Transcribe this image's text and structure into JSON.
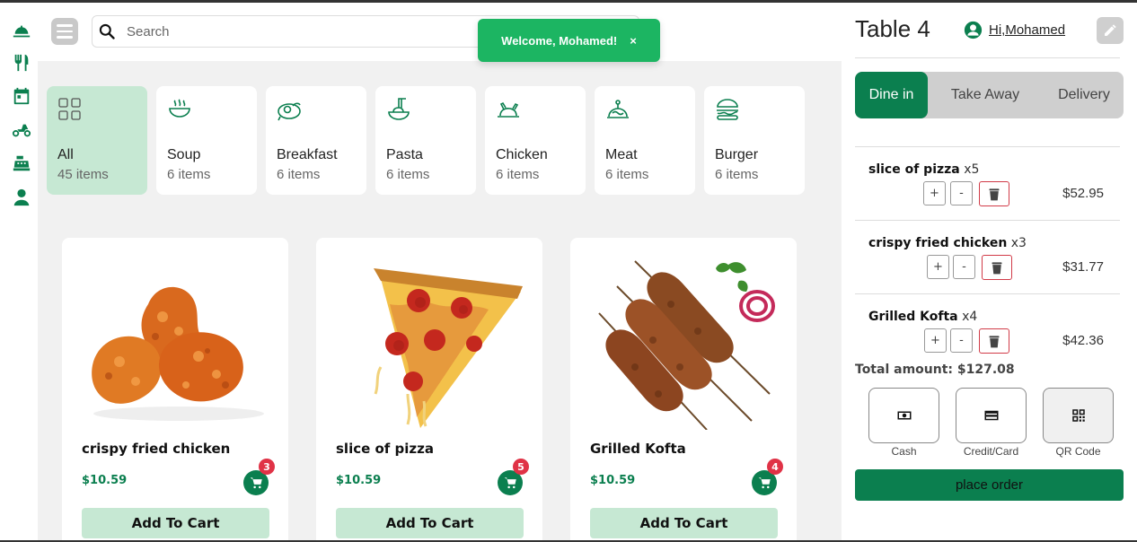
{
  "colors": {
    "accent": "#0b7f4f",
    "accent_light": "#c6e8d3",
    "toast": "#1cb562",
    "badge": "#e03246"
  },
  "sidebar": {
    "icons": [
      "bell-service-icon",
      "utensils-icon",
      "calendar-icon",
      "motorcycle-icon",
      "cash-register-icon",
      "user-icon"
    ]
  },
  "search": {
    "placeholder": "Search",
    "value": ""
  },
  "toast": {
    "message": "Welcome, Mohamed!",
    "close": "×"
  },
  "categories": [
    {
      "name": "All",
      "count": "45 items",
      "icon": "grid-icon",
      "active": true
    },
    {
      "name": "Soup",
      "count": "6 items",
      "icon": "soup-bowl-icon"
    },
    {
      "name": "Breakfast",
      "count": "6 items",
      "icon": "breakfast-icon"
    },
    {
      "name": "Pasta",
      "count": "6 items",
      "icon": "pasta-icon"
    },
    {
      "name": "Chicken",
      "count": "6 items",
      "icon": "chicken-icon"
    },
    {
      "name": "Meat",
      "count": "6 items",
      "icon": "meat-dish-icon"
    },
    {
      "name": "Burger",
      "count": "6 items",
      "icon": "burger-icon"
    }
  ],
  "products": [
    {
      "title": "crispy fried chicken",
      "price": "$10.59",
      "badge": "3",
      "button": "Add To Cart"
    },
    {
      "title": "slice of pizza",
      "price": "$10.59",
      "badge": "5",
      "button": "Add To Cart"
    },
    {
      "title": "Grilled Kofta",
      "price": "$10.59",
      "badge": "4",
      "button": "Add To Cart"
    }
  ],
  "panel": {
    "table": "Table 4",
    "user": "Hi,Mohamed",
    "tabs": [
      "Dine in",
      "Take Away",
      "Delivery"
    ],
    "active_tab": "Dine in",
    "order_items": [
      {
        "name": "slice of pizza",
        "qty": "x5",
        "price": "$52.95"
      },
      {
        "name": "crispy fried chicken",
        "qty": "x3",
        "price": "$31.77"
      },
      {
        "name": "Grilled Kofta",
        "qty": "x4",
        "price": "$42.36"
      }
    ],
    "plus": "+",
    "minus": "-",
    "total": "Total amount: $127.08",
    "payment": [
      {
        "label": "Cash",
        "icon": "cash-icon"
      },
      {
        "label": "Credit/Card",
        "icon": "credit-card-icon"
      },
      {
        "label": "QR Code",
        "icon": "qr-code-icon",
        "selected": true
      }
    ],
    "place_order": "place order"
  }
}
